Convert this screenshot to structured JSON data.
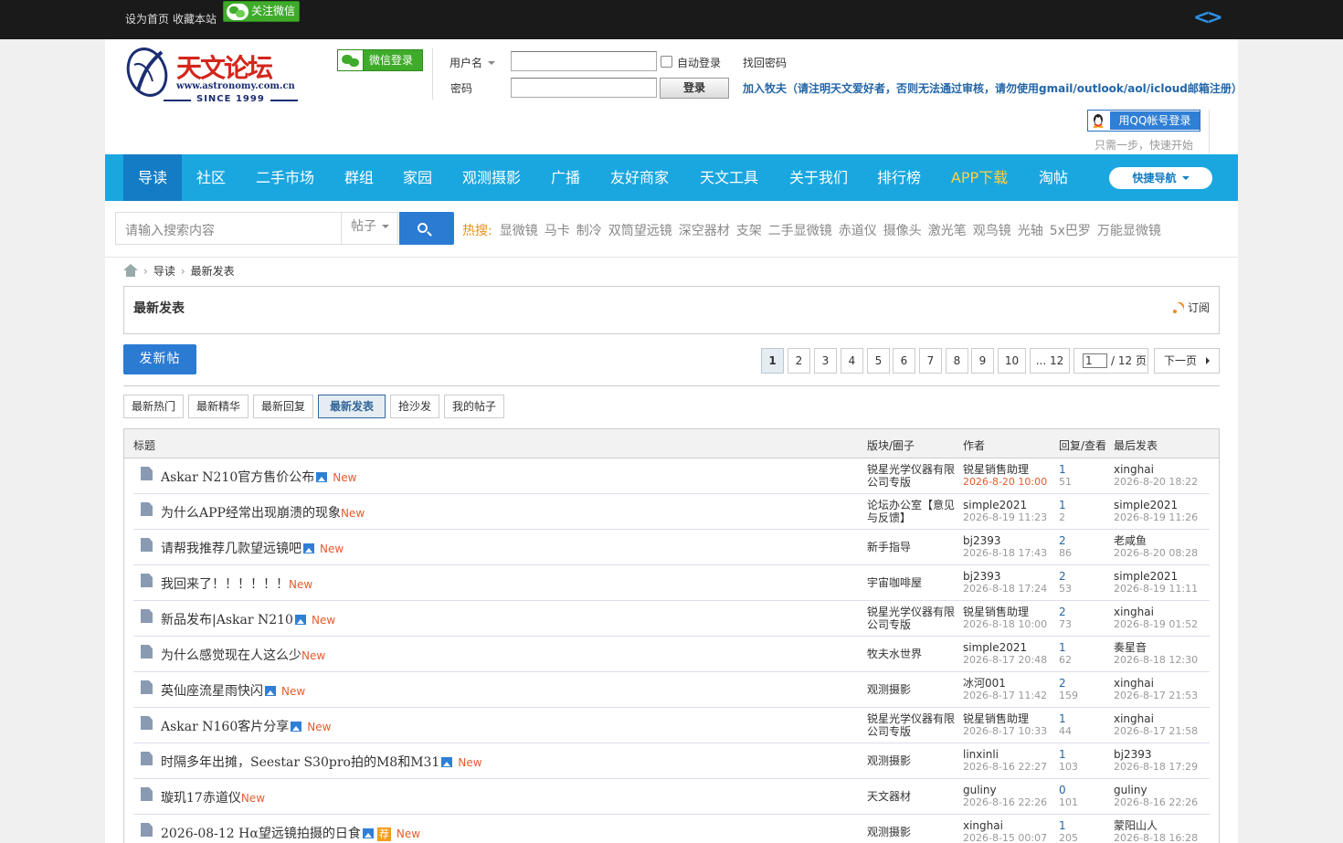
{
  "topbar": {
    "set_home": "设为首页",
    "bookmark": "收藏本站",
    "follow_wechat": "关注微信"
  },
  "logo": {
    "brand": "天文论坛",
    "mark": "牧夫",
    "url": "www.astronomy.com.cn",
    "since": "SINCE 1999"
  },
  "login": {
    "wechat_login": "微信登录",
    "username_label": "用户名",
    "password_label": "密码",
    "auto_login": "自动登录",
    "find_password": "找回密码",
    "login_button": "登录",
    "join_text": "加入牧夫（请注明天文爱好者，否则无法通过审核，请勿使用gmail/outlook/aol/icloud邮箱注册）",
    "qq_login": "用QQ帐号登录",
    "qq_sub": "只需一步，快速开始"
  },
  "nav": {
    "items": [
      "导读",
      "社区",
      "二手市场",
      "群组",
      "家园",
      "观测摄影",
      "广播",
      "友好商家",
      "天文工具",
      "关于我们",
      "排行榜",
      "APP下载",
      "淘帖"
    ],
    "quick_nav": "快捷导航",
    "accent_color": "#1aa7e0",
    "active_color": "#137cc4"
  },
  "search": {
    "placeholder": "请输入搜索内容",
    "type": "帖子",
    "hot_label": "热搜:",
    "keywords": [
      "显微镜",
      "马卡",
      "制冷",
      "双筒望远镜",
      "深空器材",
      "支架",
      "二手显微镜",
      "赤道仪",
      "摄像头",
      "激光笔",
      "观鸟镜",
      "光轴",
      "5x巴罗",
      "万能显微镜"
    ]
  },
  "breadcrumb": {
    "items": [
      "导读",
      "最新发表"
    ]
  },
  "page": {
    "title": "最新发表",
    "subscribe": "订阅",
    "post_button": "发新帖"
  },
  "pager": {
    "pages": [
      "1",
      "2",
      "3",
      "4",
      "5",
      "6",
      "7",
      "8",
      "9",
      "10",
      "... 12"
    ],
    "current": "1",
    "input_value": "1",
    "total": "/ 12 页",
    "next": "下一页"
  },
  "filters": {
    "tabs": [
      "最新热门",
      "最新精华",
      "最新回复",
      "最新发表",
      "抢沙发",
      "我的帖子"
    ],
    "active": "最新发表"
  },
  "table": {
    "headers": {
      "title": "标题",
      "forum": "版块/圈子",
      "author": "作者",
      "replies": "回复/查看",
      "last": "最后发表"
    },
    "new_label": "New",
    "rec_label": "荐",
    "rows": [
      {
        "title": "Askar N210官方售价公布",
        "img": true,
        "rec": false,
        "forum": "锐星光学仪器有限公司专版",
        "author": "锐星销售助理",
        "date": "2026-8-20 10:00",
        "hot": true,
        "replies": "1",
        "views": "51",
        "last_user": "xinghai",
        "last_date": "2026-8-20 18:22"
      },
      {
        "title": "为什么APP经常出现崩溃的现象",
        "img": false,
        "rec": false,
        "forum": "论坛办公室【意见与反馈】",
        "author": "simple2021",
        "date": "2026-8-19 11:23",
        "hot": false,
        "replies": "1",
        "views": "2",
        "last_user": "simple2021",
        "last_date": "2026-8-19 11:26"
      },
      {
        "title": "请帮我推荐几款望远镜吧",
        "img": true,
        "rec": false,
        "forum": "新手指导",
        "author": "bj2393",
        "date": "2026-8-18 17:43",
        "hot": false,
        "replies": "2",
        "views": "86",
        "last_user": "老咸鱼",
        "last_date": "2026-8-20 08:28"
      },
      {
        "title": "我回来了！！！！！！",
        "img": false,
        "rec": false,
        "forum": "宇宙咖啡屋",
        "author": "bj2393",
        "date": "2026-8-18 17:24",
        "hot": false,
        "replies": "2",
        "views": "53",
        "last_user": "simple2021",
        "last_date": "2026-8-19 11:11"
      },
      {
        "title": "新品发布|Askar N210",
        "img": true,
        "rec": false,
        "forum": "锐星光学仪器有限公司专版",
        "author": "锐星销售助理",
        "date": "2026-8-18 10:00",
        "hot": false,
        "replies": "2",
        "views": "73",
        "last_user": "xinghai",
        "last_date": "2026-8-19 01:52"
      },
      {
        "title": "为什么感觉现在人这么少",
        "img": false,
        "rec": false,
        "forum": "牧夫水世界",
        "author": "simple2021",
        "date": "2026-8-17 20:48",
        "hot": false,
        "replies": "1",
        "views": "62",
        "last_user": "奏星音",
        "last_date": "2026-8-18 12:30"
      },
      {
        "title": "英仙座流星雨快闪",
        "img": true,
        "rec": false,
        "forum": "观测摄影",
        "author": "冰河001",
        "date": "2026-8-17 11:42",
        "hot": false,
        "replies": "2",
        "views": "159",
        "last_user": "xinghai",
        "last_date": "2026-8-17 21:53"
      },
      {
        "title": "Askar N160客片分享",
        "img": true,
        "rec": false,
        "forum": "锐星光学仪器有限公司专版",
        "author": "锐星销售助理",
        "date": "2026-8-17 10:33",
        "hot": false,
        "replies": "1",
        "views": "44",
        "last_user": "xinghai",
        "last_date": "2026-8-17 21:58"
      },
      {
        "title": "时隔多年出摊，Seestar S30pro拍的M8和M31",
        "img": true,
        "rec": false,
        "forum": "观测摄影",
        "author": "linxinli",
        "date": "2026-8-16 22:27",
        "hot": false,
        "replies": "1",
        "views": "103",
        "last_user": "bj2393",
        "last_date": "2026-8-18 17:29"
      },
      {
        "title": "璇玑17赤道仪",
        "img": false,
        "rec": false,
        "forum": "天文器材",
        "author": "guliny",
        "date": "2026-8-16 22:26",
        "hot": false,
        "replies": "0",
        "views": "101",
        "last_user": "guliny",
        "last_date": "2026-8-16 22:26"
      },
      {
        "title": "2026-08-12 Hα望远镜拍摄的日食",
        "img": true,
        "rec": true,
        "forum": "观测摄影",
        "author": "xinghai",
        "date": "2026-8-15 00:07",
        "hot": false,
        "replies": "1",
        "views": "205",
        "last_user": "蒙阳山人",
        "last_date": "2026-8-18 16:28"
      }
    ]
  }
}
